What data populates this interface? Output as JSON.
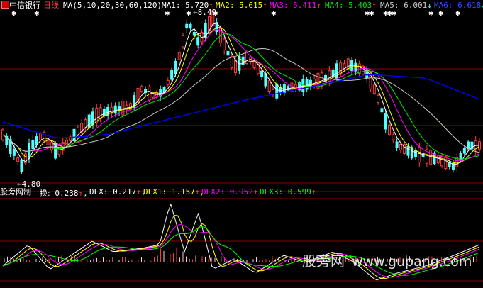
{
  "colors": {
    "background": "#000000",
    "up": "#ff3c3c",
    "down": "#54fcfc",
    "ma1": "#ffffff",
    "ma2": "#ffff00",
    "ma3": "#ff00ff",
    "ma4": "#00e600",
    "ma5": "#c8c8c8",
    "ma6": "#0000ff",
    "grid": "#8b0000",
    "dlx": "#ffffff",
    "dlx1": "#ffff00",
    "dlx2": "#ff00ff",
    "dlx3": "#00ff00"
  },
  "header": {
    "stock_name": "中信银行",
    "period": "日线",
    "ma_params": "MA(5,10,20,30,60,120)",
    "ma1_label": "MA1:",
    "ma1_value": "5.720",
    "ma1_arrow": "↑",
    "ma2_label": "MA2:",
    "ma2_value": "5.615",
    "ma2_arrow": "↑",
    "ma3_label": "MA3:",
    "ma3_value": "5.411",
    "ma3_arrow": "↑",
    "ma4_label": "MA4:",
    "ma4_value": "5.403",
    "ma4_arrow": "↑",
    "ma5_label": "MA5:",
    "ma5_value": "6.001",
    "ma5_arrow": "↓",
    "ma6_label": "MA6:",
    "ma6_value": "6.618",
    "ma6_arrow": "↓"
  },
  "indicator": {
    "name": "股旁网制",
    "huan_label": "换:",
    "huan_value": "0.238",
    "huan_arrow": "↑",
    "dlx_label": "DLX:",
    "dlx_value": "0.217",
    "dlx_arrow": "↑",
    "dlx1_label": "DLX1:",
    "dlx1_value": "1.157",
    "dlx1_arrow": "↑",
    "dlx2_label": "DLX2:",
    "dlx2_value": "0.952",
    "dlx2_arrow": "↑",
    "dlx3_label": "DLX3:",
    "dlx3_value": "0.599",
    "dlx3_arrow": "↑"
  },
  "annotations": {
    "high_price": "8.49",
    "low_price": "4.80"
  },
  "watermark": {
    "site_cn": "股旁网",
    "site_url": "www.gupang.com"
  }
}
